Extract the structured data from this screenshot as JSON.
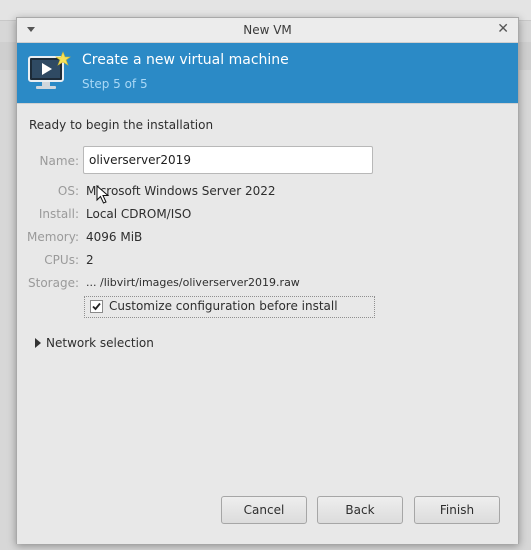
{
  "window": {
    "title": "New VM"
  },
  "header": {
    "title": "Create a new virtual machine",
    "step": "Step 5 of 5"
  },
  "summary": {
    "heading": "Ready to begin the installation",
    "fields": {
      "name": {
        "label": "Name:",
        "value": "oliverserver2019"
      },
      "os": {
        "label": "OS:",
        "value": "Microsoft Windows Server 2022"
      },
      "install": {
        "label": "Install:",
        "value": "Local CDROM/ISO"
      },
      "memory": {
        "label": "Memory:",
        "value": "4096 MiB"
      },
      "cpus": {
        "label": "CPUs:",
        "value": "2"
      },
      "storage": {
        "label": "Storage:",
        "value": "... /libvirt/images/oliverserver2019.raw"
      }
    },
    "customize": {
      "label": "Customize configuration before install",
      "checked": true
    },
    "network_expander": "Network selection"
  },
  "buttons": {
    "cancel": "Cancel",
    "back": "Back",
    "finish": "Finish"
  },
  "colors": {
    "header_bg": "#2b8ac6",
    "step_text": "#a9d8f6"
  },
  "icons": {
    "window_menu": "chevron-down-icon",
    "close": "close-icon",
    "vm": "vm-monitor-icon",
    "checkbox": "checkmark-icon",
    "expander": "triangle-right-icon",
    "pointer": "mouse-pointer-icon"
  }
}
